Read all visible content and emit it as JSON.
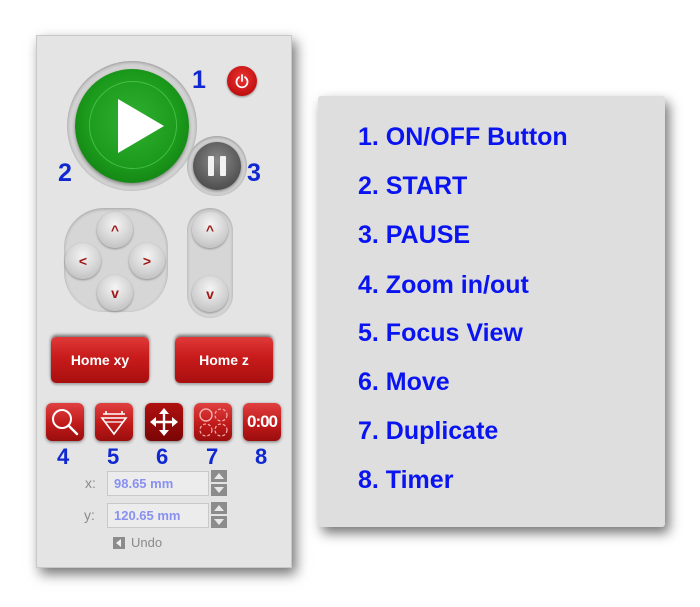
{
  "control_panel": {
    "callouts": [
      "1",
      "2",
      "3",
      "4",
      "5",
      "6",
      "7",
      "8"
    ],
    "home_xy_label": "Home xy",
    "home_z_label": "Home z",
    "timer_display": "0:00",
    "arrows": {
      "up": "^",
      "down": "v",
      "left": "<",
      "right": ">"
    },
    "x_label": "x:",
    "x_value": "98.65 mm",
    "y_label": "y:",
    "y_value": "120.65 mm",
    "undo_label": "Undo",
    "icons": [
      "power-icon",
      "play-icon",
      "pause-icon",
      "zoom-icon",
      "focus-view-icon",
      "move-icon",
      "duplicate-icon",
      "timer-icon"
    ]
  },
  "legend": {
    "items": [
      "1. ON/OFF Button",
      "2. START",
      "3. PAUSE",
      "4. Zoom in/out",
      "5. Focus View",
      "6. Move",
      "7. Duplicate",
      "8. Timer"
    ]
  },
  "colors": {
    "callout_blue": "#1028d0",
    "legend_blue": "#0a14f0",
    "button_red": "#c81b1b",
    "start_green": "#1b9a1b",
    "field_text": "#8890f0"
  }
}
